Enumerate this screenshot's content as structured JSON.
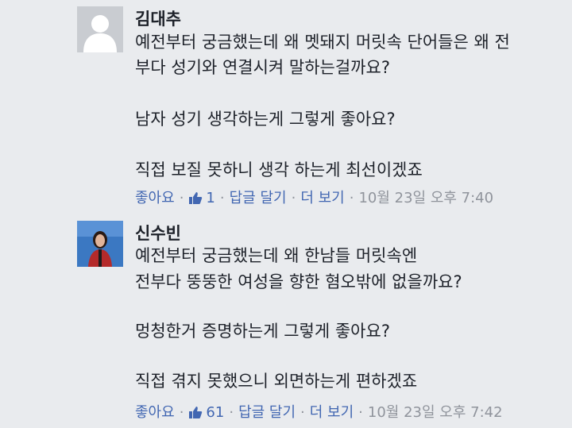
{
  "comments": [
    {
      "author": "김대추",
      "avatar_icon": "default-profile-silhouette",
      "lines": [
        "예전부터 궁금했는데 왜 멧돼지 머릿속 단어들은 왜 전",
        "부다 성기와 연결시켜 말하는걸까요?",
        "",
        "남자 성기 생각하는게 그렇게 좋아요?",
        "",
        "직접 보질 못하니 생각 하는게 최선이겠죠"
      ],
      "like_label": "좋아요",
      "like_count": "1",
      "reply_label": "답글 달기",
      "more_label": "더 보기",
      "timestamp": "10월 23일 오후 7:40"
    },
    {
      "author": "신수빈",
      "avatar_icon": "profile-photo",
      "lines": [
        "예전부터 궁금했는데 왜 한남들 머릿속엔",
        "전부다 뚱뚱한 여성을 향한 혐오밖에 없을까요?",
        "",
        "멍청한거 증명하는게 그렇게 좋아요?",
        "",
        "직접 겪지 못했으니 외면하는게 편하겠죠"
      ],
      "like_label": "좋아요",
      "like_count": "61",
      "reply_label": "답글 달기",
      "more_label": "더 보기",
      "timestamp": "10월 23일 오후 7:42"
    }
  ],
  "colors": {
    "background": "#e9ebee",
    "text": "#1d2129",
    "link": "#4267b2",
    "meta": "#90949c"
  }
}
